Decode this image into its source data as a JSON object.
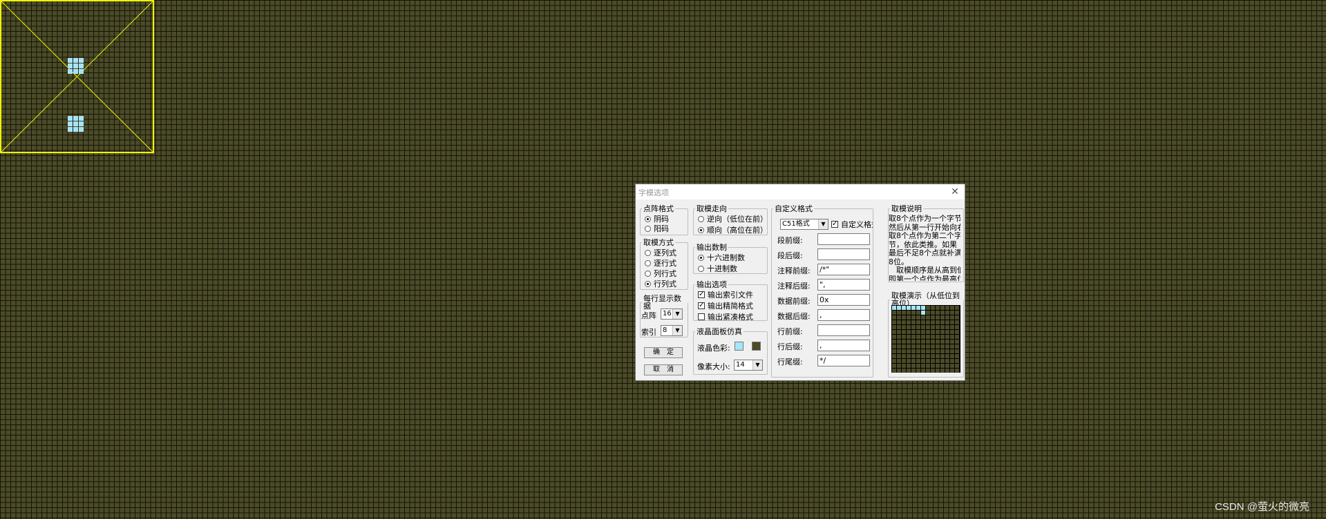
{
  "window": {
    "title": "字模选项",
    "close_glyph": "✕"
  },
  "dot_format": {
    "legend": "点阵格式",
    "options": [
      "阴码",
      "阳码"
    ],
    "selected_index": 0
  },
  "take_mode": {
    "legend": "取模方式",
    "options": [
      "逐列式",
      "逐行式",
      "列行式",
      "行列式"
    ],
    "selected_index": 3
  },
  "per_row": {
    "legend": "每行显示数据",
    "dots_label": "点阵",
    "dots_value": "16",
    "index_label": "索引",
    "index_value": "8"
  },
  "buttons": {
    "ok": "确　定",
    "cancel": "取　消"
  },
  "direction": {
    "legend": "取模走向",
    "options": [
      "逆向（低位在前）",
      "顺向（高位在前）"
    ],
    "selected_index": 1
  },
  "radix": {
    "legend": "输出数制",
    "options": [
      "十六进制数",
      "十进制数"
    ],
    "selected_index": 0
  },
  "output": {
    "legend": "输出选项",
    "options": [
      {
        "label": "输出索引文件",
        "checked": true
      },
      {
        "label": "输出精简格式",
        "checked": true
      },
      {
        "label": "输出紧凑格式",
        "checked": false
      }
    ]
  },
  "lcd": {
    "legend": "液晶面板仿真",
    "color_label": "液晶色彩:",
    "color_fg": "#a8e4f8",
    "color_bg": "#4b4b28",
    "size_label": "像素大小:",
    "size_value": "14"
  },
  "custom": {
    "legend": "自定义格式",
    "format_value": "C51格式",
    "custom_check_label": "自定义格式",
    "custom_checked": true,
    "fields": [
      {
        "label": "段前缀:",
        "value": ""
      },
      {
        "label": "段后缀:",
        "value": ""
      },
      {
        "label": "注释前缀:",
        "value": "/*\""
      },
      {
        "label": "注释后缀:",
        "value": "\","
      },
      {
        "label": "数据前缀:",
        "value": "0x"
      },
      {
        "label": "数据后缀:",
        "value": ","
      },
      {
        "label": "行前缀:",
        "value": ""
      },
      {
        "label": "行后缀:",
        "value": ","
      },
      {
        "label": "行尾缀:",
        "value": "*/"
      }
    ]
  },
  "explain": {
    "legend": "取模说明",
    "lines": [
      "取8个点作为一个字节，",
      "然后从第一行开始向右",
      "取8个点作为第二个字",
      "节，依此类推。如果",
      "最后不足8个点就补满",
      "8位。",
      "　取模顺序是从高到低，",
      "即第一个点作为最高位。"
    ]
  },
  "demo": {
    "legend": "取模演示（从低位到高位）"
  },
  "watermark": "CSDN @萤火的微亮"
}
